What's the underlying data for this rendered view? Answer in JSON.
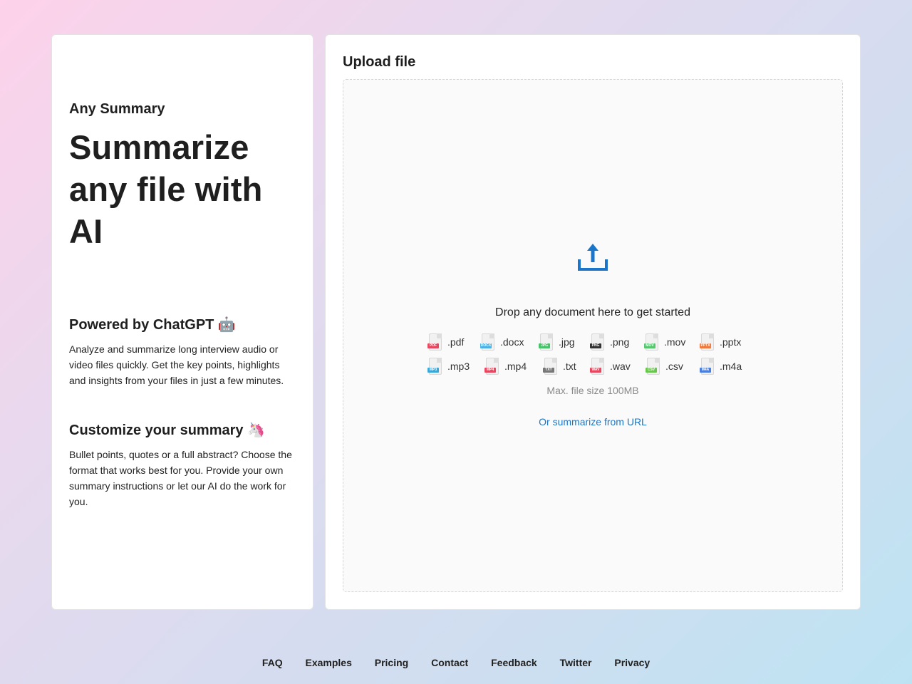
{
  "left": {
    "brand": "Any Summary",
    "hero": "Summarize any file with AI",
    "feature1": {
      "title": "Powered by ChatGPT 🤖",
      "text": "Analyze and summarize long interview audio or video files quickly. Get the key points, highlights and insights from your files in just a few minutes."
    },
    "feature2": {
      "title": "Customize your summary 🦄",
      "text": "Bullet points, quotes or a full abstract? Choose the format that works best for you. Provide your own summary instructions or let our AI do the work for you."
    }
  },
  "upload": {
    "title": "Upload file",
    "drop_text": "Drop any document here to get started",
    "max_size": "Max. file size 100MB",
    "url_link": "Or summarize from URL",
    "accent": "#1b76c9"
  },
  "file_types": [
    {
      "ext": ".pdf",
      "tag": "PDF",
      "color": "#e8475f"
    },
    {
      "ext": ".docx",
      "tag": "DOCX",
      "color": "#4ab0e6"
    },
    {
      "ext": ".jpg",
      "tag": "JPG",
      "color": "#47c46a"
    },
    {
      "ext": ".png",
      "tag": "PNG",
      "color": "#333333"
    },
    {
      "ext": ".mov",
      "tag": "MOV",
      "color": "#56c66f"
    },
    {
      "ext": ".pptx",
      "tag": "PPTX",
      "color": "#f07a3e"
    },
    {
      "ext": ".mp3",
      "tag": "MP3",
      "color": "#3ba6d8"
    },
    {
      "ext": ".mp4",
      "tag": "MP4",
      "color": "#e8475f"
    },
    {
      "ext": ".txt",
      "tag": "TXT",
      "color": "#777777"
    },
    {
      "ext": ".wav",
      "tag": "WAV",
      "color": "#e8475f"
    },
    {
      "ext": ".csv",
      "tag": "CSV",
      "color": "#6ac44f"
    },
    {
      "ext": ".m4a",
      "tag": "M4A",
      "color": "#4a7fe0"
    }
  ],
  "footer": {
    "faq": "FAQ",
    "examples": "Examples",
    "pricing": "Pricing",
    "contact": "Contact",
    "feedback": "Feedback",
    "twitter": "Twitter",
    "privacy": "Privacy"
  }
}
